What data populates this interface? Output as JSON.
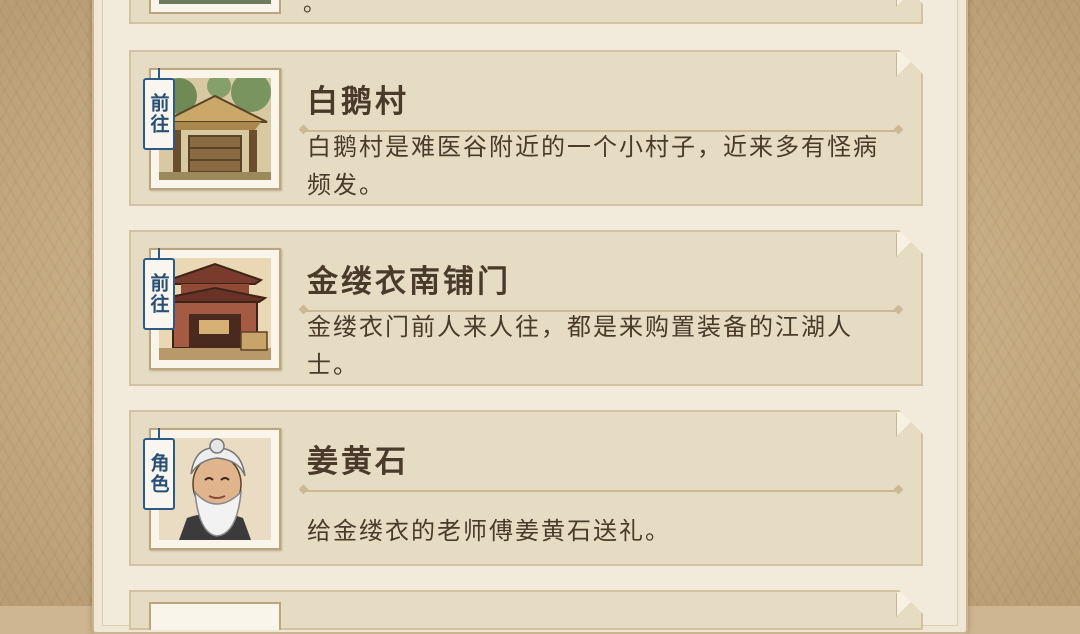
{
  "top_card": {
    "desc_tail": "。"
  },
  "quests": [
    {
      "tag": "前往",
      "title": "白鹅村",
      "desc": "白鹅村是难医谷附近的一个小村子，近来多有怪病频发。",
      "icon": "village-hut-icon"
    },
    {
      "tag": "前往",
      "title": "金缕衣南铺门",
      "desc": "金缕衣门前人来人往，都是来购置装备的江湖人士。",
      "icon": "shop-gate-icon"
    },
    {
      "tag": "角色",
      "title": "姜黄石",
      "desc": "给金缕衣的老师傅姜黄石送礼。",
      "icon": "old-man-portrait-icon"
    }
  ],
  "colors": {
    "tag_blue": "#2d5b86",
    "title_brown": "#4a3a2a",
    "card_bg": "#e6dcc4"
  }
}
